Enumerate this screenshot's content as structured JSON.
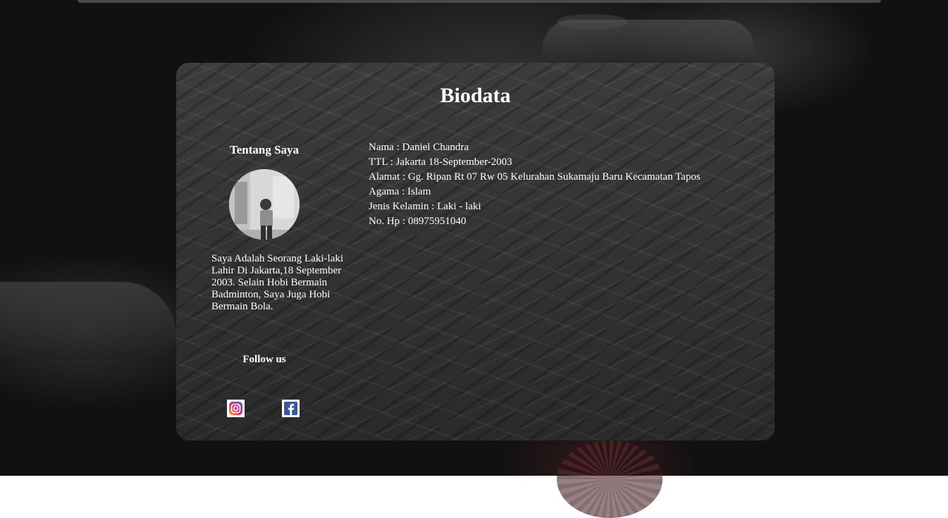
{
  "page": {
    "title": "Biodata"
  },
  "about": {
    "heading": "Tentang Saya",
    "description": "Saya Adalah Seorang Laki-laki Lahir Di Jakarta,18 September 2003. Selain Hobi Bermain Badminton, Saya Juga Hobi Bermain Bola."
  },
  "follow": {
    "heading": "Follow us",
    "icons": [
      "instagram-icon",
      "facebook-icon"
    ]
  },
  "biodata": {
    "nama": "Nama : Daniel Chandra",
    "ttl": "TTL : Jakarta 18-September-2003",
    "alamat": "Alamat : Gg. Ripan Rt 07 Rw 05 Kelurahan Sukamaju Baru Kecamatan Tapos",
    "agama": "Agama : Islam",
    "jenis_kelamin": "Jenis Kelamin : Laki - laki",
    "no_hp": "No. Hp : 08975951040"
  },
  "colors": {
    "text": "#ffffff",
    "card": "#333333",
    "background": "#0b0b0b",
    "facebook": "#3b5998"
  }
}
